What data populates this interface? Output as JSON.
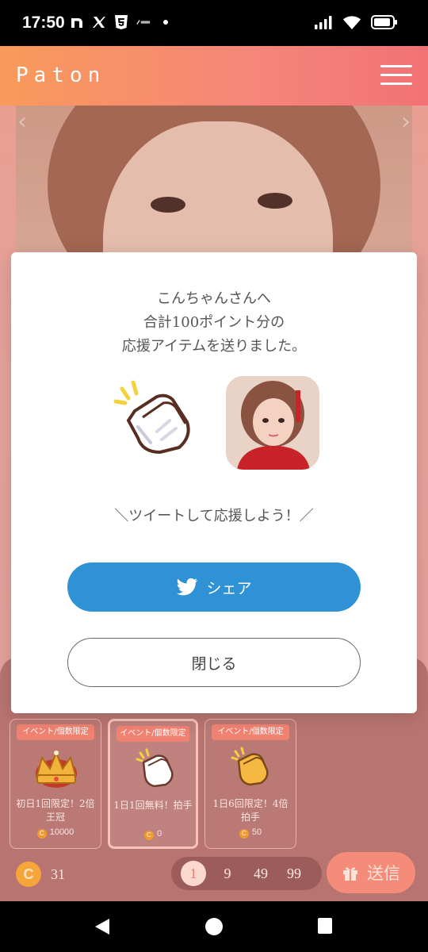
{
  "status_bar": {
    "time": "17:50",
    "notification_icons": [
      "n-icon",
      "x-icon",
      "html5-icon",
      "smbc-icon",
      "dot-icon"
    ],
    "system_icons": [
      "signal-icon",
      "wifi-icon",
      "battery-icon"
    ]
  },
  "header": {
    "logo": "Paton",
    "menu_icon": "hamburger-icon"
  },
  "modal": {
    "message_lines": [
      "こんちゃんさんへ",
      "合計100ポイント分の",
      "応援アイテムを送りました。"
    ],
    "cta": "＼ツイートして応援しよう！／",
    "share_label": "シェア",
    "close_label": "閉じる"
  },
  "items": [
    {
      "tag": "イベント/個数限定",
      "name": "初日1回限定！2倍王冠",
      "price": "10000",
      "icon": "crown-icon"
    },
    {
      "tag": "イベント/個数限定",
      "name": "1日1回無料！拍手",
      "price": "0",
      "icon": "clap-icon",
      "selected": true
    },
    {
      "tag": "イベント/個数限定",
      "name": "1日6回限定！4倍拍手",
      "price": "50",
      "icon": "clap-gold-icon"
    }
  ],
  "balance": {
    "coin_letter": "C",
    "amount": "31"
  },
  "quantities": [
    "1",
    "9",
    "49",
    "99"
  ],
  "selected_quantity": "1",
  "send_label": "送信",
  "colors": {
    "header_gradient_start": "#f99a5a",
    "header_gradient_end": "#f17274",
    "twitter_blue": "#2f92d5",
    "panel": "#b87470",
    "tag": "#f08272"
  }
}
